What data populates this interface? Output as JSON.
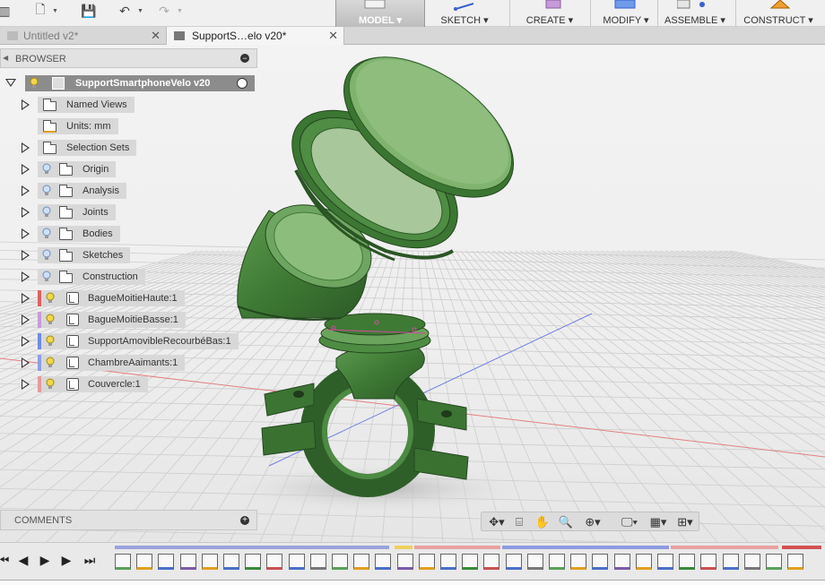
{
  "toolbar": {
    "workspace": "MODEL ▾",
    "tools": [
      {
        "label": "SKETCH ▾",
        "icon": "sketch-icon"
      },
      {
        "label": "CREATE ▾",
        "icon": "create-icon"
      },
      {
        "label": "MODIFY ▾",
        "icon": "modify-icon"
      },
      {
        "label": "ASSEMBLE ▾",
        "icon": "assemble-icon"
      },
      {
        "label": "CONSTRUCT ▾",
        "icon": "construct-icon"
      }
    ],
    "quick_access": [
      "file-icon",
      "save-icon",
      "undo-icon",
      "redo-icon"
    ]
  },
  "tabs": [
    {
      "label": "Untitled v2*",
      "active": false
    },
    {
      "label": "SupportS…elo v20*",
      "active": true
    }
  ],
  "browser": {
    "title": "BROWSER",
    "root": "SupportSmartphoneVelo v20",
    "items": [
      {
        "label": "Named Views",
        "kind": "folder",
        "bulb": false
      },
      {
        "label": "Units: mm",
        "kind": "units",
        "bulb": false
      },
      {
        "label": "Selection Sets",
        "kind": "folder",
        "bulb": false
      },
      {
        "label": "Origin",
        "kind": "folder",
        "bulb": true
      },
      {
        "label": "Analysis",
        "kind": "folder",
        "bulb": true
      },
      {
        "label": "Joints",
        "kind": "folder",
        "bulb": true
      },
      {
        "label": "Bodies",
        "kind": "folder",
        "bulb": true
      },
      {
        "label": "Sketches",
        "kind": "folder",
        "bulb": true
      },
      {
        "label": "Construction",
        "kind": "folder",
        "bulb": true
      },
      {
        "label": "BagueMoitieHaute:1",
        "kind": "component",
        "bulb": true,
        "color": "#e06060"
      },
      {
        "label": "BagueMoitieBasse:1",
        "kind": "component",
        "bulb": true,
        "color": "#c89ad8"
      },
      {
        "label": "SupportAmovibleRecourbéBas:1",
        "kind": "component",
        "bulb": true,
        "color": "#6f8be8"
      },
      {
        "label": "ChambreAaimants:1",
        "kind": "component",
        "bulb": true,
        "color": "#8f9de6"
      },
      {
        "label": "Couvercle:1",
        "kind": "component",
        "bulb": true,
        "color": "#e89a9a"
      }
    ]
  },
  "comments": {
    "title": "COMMENTS"
  },
  "colors": {
    "model_green": "#3e7a34",
    "grid": "#c7c7c7",
    "red_axis": "#e07070",
    "blue_axis": "#6f7fe0"
  }
}
